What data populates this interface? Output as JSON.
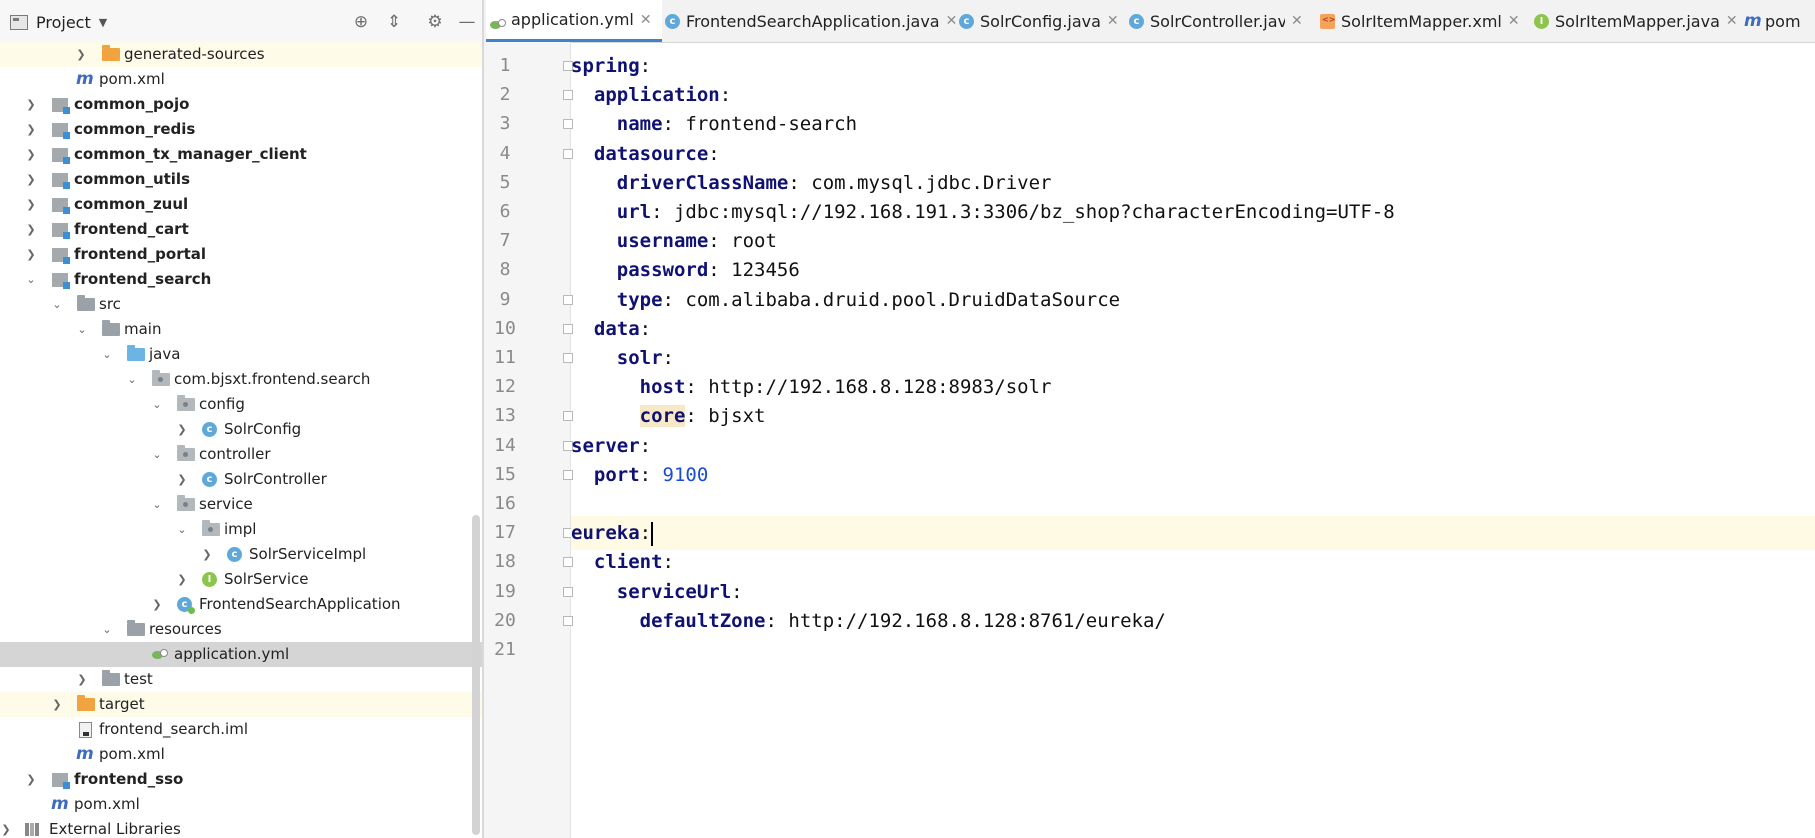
{
  "project_panel": {
    "title": "Project",
    "tree": [
      {
        "label": "generated-sources"
      },
      {
        "label": "pom.xml"
      },
      {
        "label": "common_pojo"
      },
      {
        "label": "common_redis"
      },
      {
        "label": "common_tx_manager_client"
      },
      {
        "label": "common_utils"
      },
      {
        "label": "common_zuul"
      },
      {
        "label": "frontend_cart"
      },
      {
        "label": "frontend_portal"
      },
      {
        "label": "frontend_search"
      },
      {
        "label": "src"
      },
      {
        "label": "main"
      },
      {
        "label": "java"
      },
      {
        "label": "com.bjsxt.frontend.search"
      },
      {
        "label": "config"
      },
      {
        "label": "SolrConfig"
      },
      {
        "label": "controller"
      },
      {
        "label": "SolrController"
      },
      {
        "label": "service"
      },
      {
        "label": "impl"
      },
      {
        "label": "SolrServiceImpl"
      },
      {
        "label": "SolrService"
      },
      {
        "label": "FrontendSearchApplication"
      },
      {
        "label": "resources"
      },
      {
        "label": "application.yml"
      },
      {
        "label": "test"
      },
      {
        "label": "target"
      },
      {
        "label": "frontend_search.iml"
      },
      {
        "label": "pom.xml"
      },
      {
        "label": "frontend_sso"
      },
      {
        "label": "pom.xml"
      },
      {
        "label": "External Libraries"
      }
    ]
  },
  "tabs": [
    {
      "label": "application.yml",
      "active": true
    },
    {
      "label": "FrontendSearchApplication.java"
    },
    {
      "label": "SolrConfig.java"
    },
    {
      "label": "SolrController.java"
    },
    {
      "label": "SolrItemMapper.xml"
    },
    {
      "label": "SolrItemMapper.java"
    },
    {
      "label": "pom"
    }
  ],
  "editor": {
    "lines": [
      {
        "n": "1",
        "key": "spring",
        "sep": ":",
        "val": ""
      },
      {
        "n": "2",
        "key": "application",
        "sep": ":",
        "val": ""
      },
      {
        "n": "3",
        "key": "name",
        "sep": ": ",
        "val": "frontend-search"
      },
      {
        "n": "4",
        "key": "datasource",
        "sep": ":",
        "val": ""
      },
      {
        "n": "5",
        "key": "driverClassName",
        "sep": ": ",
        "val": "com.mysql.jdbc.Driver"
      },
      {
        "n": "6",
        "key": "url",
        "sep": ": ",
        "val": "jdbc:mysql://192.168.191.3:3306/bz_shop?characterEncoding=UTF-8"
      },
      {
        "n": "7",
        "key": "username",
        "sep": ": ",
        "val": "root"
      },
      {
        "n": "8",
        "key": "password",
        "sep": ": ",
        "val": "123456"
      },
      {
        "n": "9",
        "key": "type",
        "sep": ": ",
        "val": "com.alibaba.druid.pool.DruidDataSource"
      },
      {
        "n": "10",
        "key": "data",
        "sep": ":",
        "val": ""
      },
      {
        "n": "11",
        "key": "solr",
        "sep": ":",
        "val": ""
      },
      {
        "n": "12",
        "key": "host",
        "sep": ": ",
        "val": "http://192.168.8.128:8983/solr"
      },
      {
        "n": "13",
        "key": "core",
        "sep": ": ",
        "val": "bjsxt"
      },
      {
        "n": "14",
        "key": "server",
        "sep": ":",
        "val": ""
      },
      {
        "n": "15",
        "key": "port",
        "sep": ": ",
        "val": "9100"
      },
      {
        "n": "16",
        "key": "",
        "sep": "",
        "val": ""
      },
      {
        "n": "17",
        "key": "eureka",
        "sep": ":",
        "val": ""
      },
      {
        "n": "18",
        "key": "client",
        "sep": ":",
        "val": ""
      },
      {
        "n": "19",
        "key": "serviceUrl",
        "sep": ":",
        "val": ""
      },
      {
        "n": "20",
        "key": "defaultZone",
        "sep": ": ",
        "val": "http://192.168.8.128:8761/eureka/"
      },
      {
        "n": "21",
        "key": "",
        "sep": "",
        "val": ""
      }
    ]
  }
}
